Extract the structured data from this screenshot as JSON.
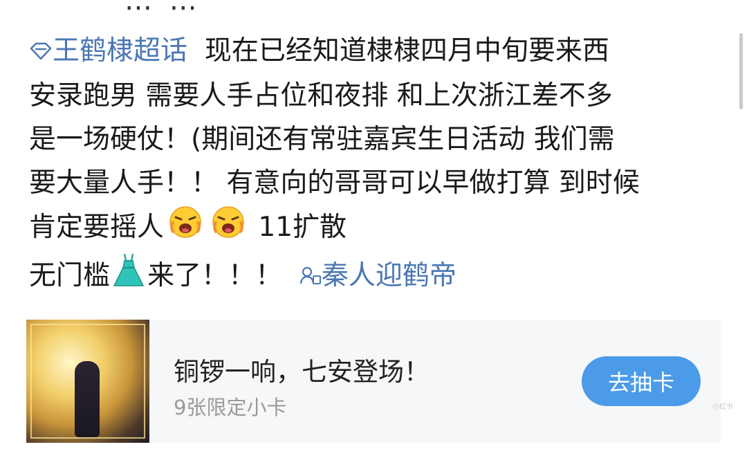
{
  "top_cut_text": "… …",
  "post": {
    "topic_icon": "diamond-icon",
    "topic": "王鹤棣超话",
    "line1_rest": "现在已经知道棣棣四月中旬要来西",
    "line2": "安录跑男 需要人手占位和夜排 和上次浙江差不多",
    "line3": "是一场硬仗！(期间还有常驻嘉宾生日活动 我们需",
    "line4": "要大量人手！！ 有意向的哥哥可以早做打算 到时候",
    "line5_text": "肯定要摇人",
    "line5_emojis": [
      "crying-face-emoji",
      "crying-face-emoji"
    ],
    "line5_tail": "11扩散",
    "line6_text": "无门槛",
    "line6_emoji": "dress-emoji",
    "line6_rest": "来了！！！",
    "tag_icon": "people-tag-icon",
    "tag": "秦人迎鹤帝"
  },
  "card": {
    "title": "铜锣一响，七安登场！",
    "subtitle": "9张限定小卡",
    "button_label": "去抽卡"
  },
  "watermark": "小红书",
  "colors": {
    "link": "#4a77b3",
    "button": "#4b9be9",
    "card_bg": "#f6f7f9"
  }
}
